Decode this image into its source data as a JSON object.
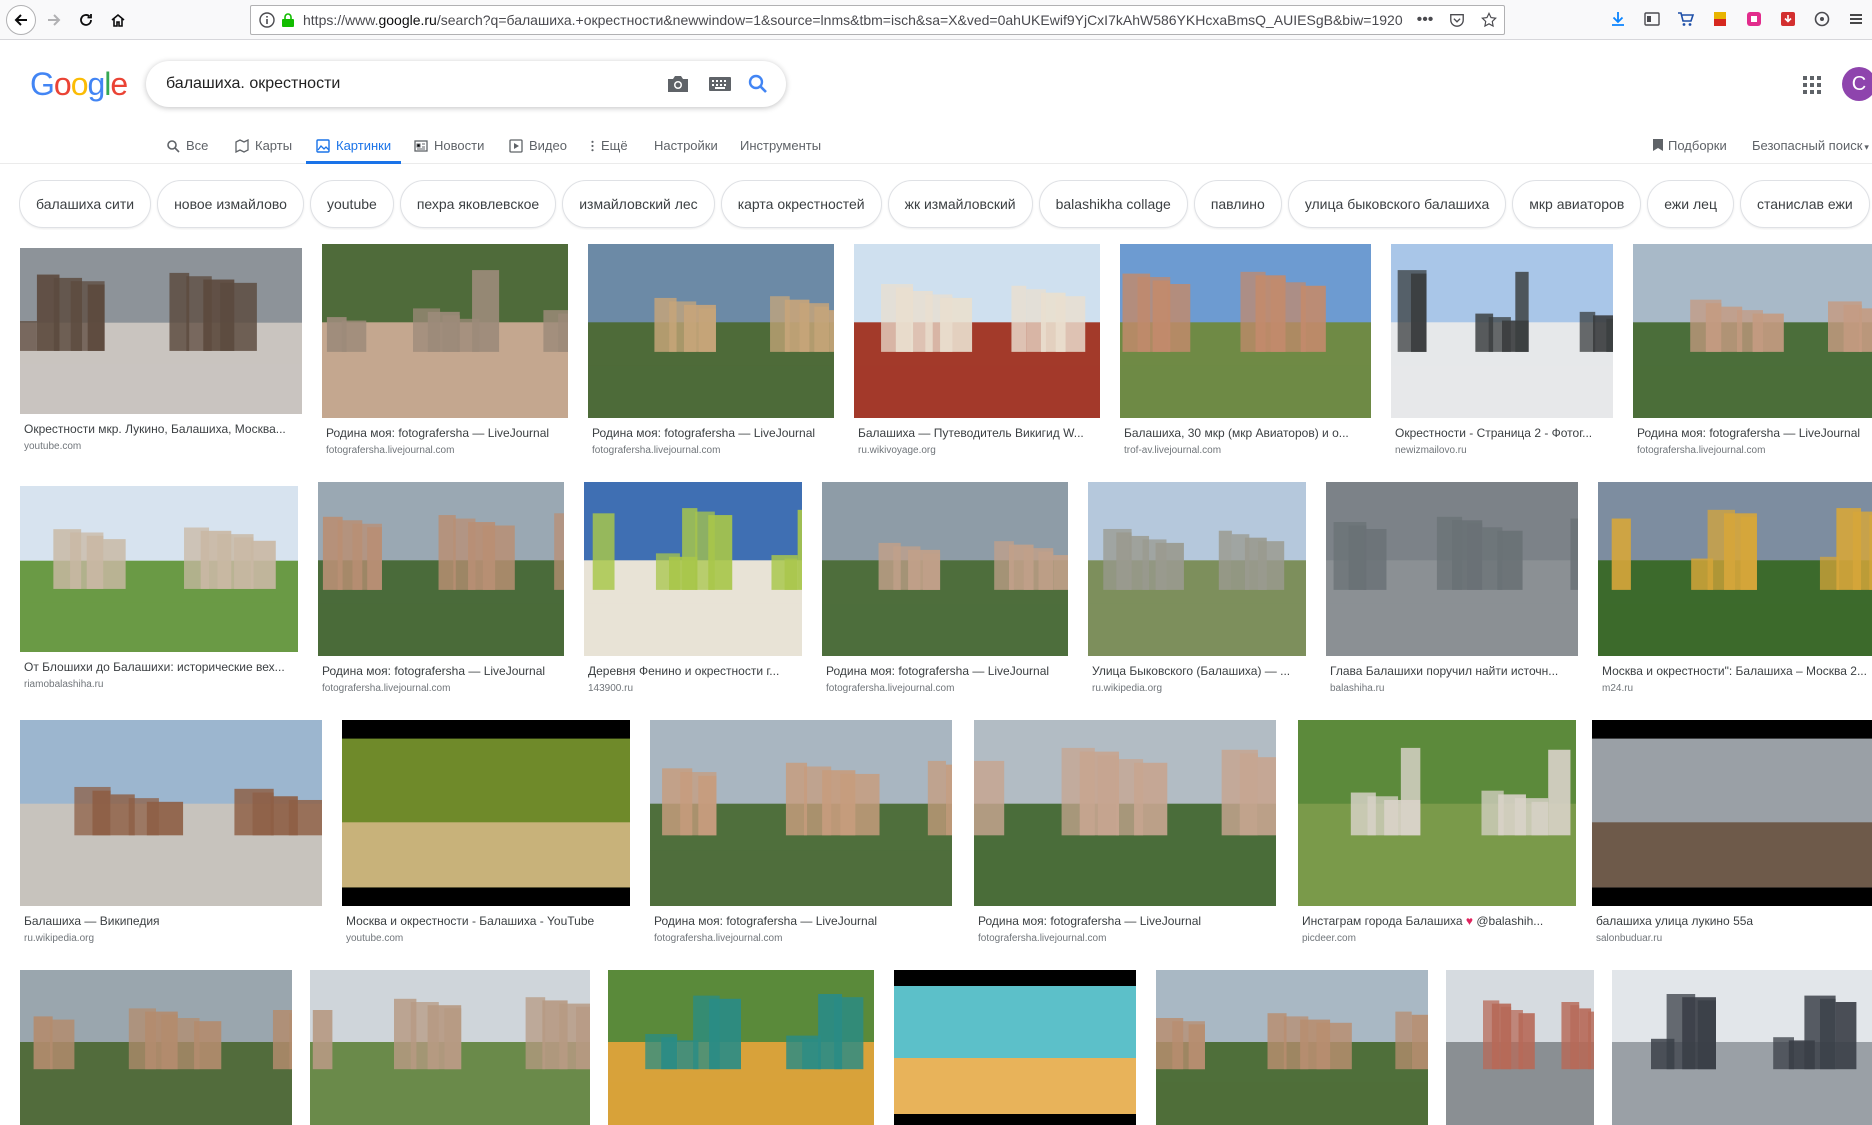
{
  "browser": {
    "url_prefix": "https://www.",
    "url_domain": "google.ru",
    "url_rest": "/search?q=балашиха.+окрестности&newwindow=1&source=lnms&tbm=isch&sa=X&ved=0ahUKEwif9YjCxI7kAhW586YKHcxaBmsQ_AUIESgB&biw=1920",
    "more_label": "•••"
  },
  "search": {
    "query": "балашиха. окрестности",
    "logo_text": "Google",
    "avatar_letter": "С"
  },
  "tabs": [
    {
      "label": "Все",
      "icon": "search-icon"
    },
    {
      "label": "Карты",
      "icon": "map-icon"
    },
    {
      "label": "Картинки",
      "icon": "image-icon",
      "active": true
    },
    {
      "label": "Новости",
      "icon": "news-icon"
    },
    {
      "label": "Видео",
      "icon": "video-icon"
    },
    {
      "label": "Ещё",
      "icon": "more-vert-icon"
    },
    {
      "label": "Настройки"
    },
    {
      "label": "Инструменты"
    }
  ],
  "tabs_right": {
    "collections": "Подборки",
    "safe_search": "Безопасный поиск"
  },
  "chips": [
    "балашиха сити",
    "новое измайлово",
    "youtube",
    "пехра яковлевское",
    "измайловский лес",
    "карта окрестностей",
    "жк измайловский",
    "balashikha collage",
    "павлино",
    "улица быковского балашиха",
    "мкр авиаторов",
    "ежи лец",
    "станислав ежи"
  ],
  "results": [
    {
      "title": "Окрестности мкр. Лукино, Балашиха, Москва...",
      "source": "youtube.com",
      "palette": [
        "#8d9399",
        "#5c4a3e",
        "#c9c4bf"
      ]
    },
    {
      "title": "Родина моя: fotografersha — LiveJournal",
      "source": "fotografersha.livejournal.com",
      "palette": [
        "#4f6b3a",
        "#9c8a7a",
        "#c4a78f"
      ]
    },
    {
      "title": "Родина моя: fotografersha — LiveJournal",
      "source": "fotografersha.livejournal.com",
      "palette": [
        "#6c8aa6",
        "#c7a57a",
        "#4e6b39"
      ]
    },
    {
      "title": "Балашиха — Путеводитель Викигид W...",
      "source": "ru.wikivoyage.org",
      "palette": [
        "#cfe0ef",
        "#e9dfcf",
        "#a33a2a"
      ]
    },
    {
      "title": "Балашиха, 30 мкр (мкр Авиаторов) и о...",
      "source": "trof-av.livejournal.com",
      "palette": [
        "#6d9bd1",
        "#c28a6c",
        "#6f8a45"
      ]
    },
    {
      "title": "Окрестности - Страница 2 - Фотог...",
      "source": "newizmailovo.ru",
      "palette": [
        "#a9c6e8",
        "#3a3d3f",
        "#e6e8ea"
      ]
    },
    {
      "title": "Родина моя: fotografersha — LiveJournal",
      "source": "fotografersha.livejournal.com",
      "palette": [
        "#a8b9c8",
        "#c59b82",
        "#4b6e3a"
      ]
    },
    {
      "title": "От Блошихи до Балашихи: исторические вех...",
      "source": "riamobalashiha.ru",
      "palette": [
        "#d7e3ef",
        "#c9b8a4",
        "#6a9a45"
      ]
    },
    {
      "title": "Родина моя: fotografersha — LiveJournal",
      "source": "fotografersha.livejournal.com",
      "palette": [
        "#9aa8b3",
        "#b98f74",
        "#4a6b3a"
      ]
    },
    {
      "title": "Деревня Фенино и окрестности г...",
      "source": "143900.ru",
      "palette": [
        "#3f6fb3",
        "#a8c64a",
        "#e8e3d6"
      ]
    },
    {
      "title": "Родина моя: fotografersha — LiveJournal",
      "source": "fotografersha.livejournal.com",
      "palette": [
        "#8e9ca7",
        "#c1a089",
        "#4e6e3c"
      ]
    },
    {
      "title": "Улица Быковского (Балашиха) — ...",
      "source": "ru.wikipedia.org",
      "palette": [
        "#b5c8dc",
        "#9a9a8f",
        "#7d8f5c"
      ]
    },
    {
      "title": "Глава Балашихи поручил найти источн...",
      "source": "balashiha.ru",
      "palette": [
        "#7c8288",
        "#6a7176",
        "#8b9094"
      ]
    },
    {
      "title": "Москва и окрестности\": Балашиха – Москва 2...",
      "source": "m24.ru",
      "palette": [
        "#7d8da0",
        "#d6a63a",
        "#3c6a2c"
      ]
    },
    {
      "title": "Балашиха — Википедия",
      "source": "ru.wikipedia.org",
      "palette": [
        "#9cb6cf",
        "#8e5f45",
        "#c7c3bd"
      ]
    },
    {
      "title": "Москва и окрестности - Балашиха - YouTube",
      "source": "youtube.com",
      "palette": [
        "#000000",
        "#6f8a2a",
        "#c8b27a"
      ]
    },
    {
      "title": "Родина моя: fotografersha — LiveJournal",
      "source": "fotografersha.livejournal.com",
      "palette": [
        "#a9b6c1",
        "#c79c7d",
        "#4f6f3c"
      ]
    },
    {
      "title": "Родина моя: fotografersha — LiveJournal",
      "source": "fotografersha.livejournal.com",
      "palette": [
        "#b2bcc4",
        "#c7a590",
        "#4a6d3a"
      ]
    },
    {
      "title": "Инстаграм города Балашиха ♥ @balashih...",
      "source": "picdeer.com",
      "palette": [
        "#5c8a3b",
        "#d8d2c8",
        "#7a9a4a"
      ]
    },
    {
      "title": "балашиха улица лукино 55а",
      "source": "salonbuduar.ru",
      "palette": [
        "#000000",
        "#9aa0a6",
        "#6e5a4a"
      ]
    },
    {
      "title": "",
      "source": "",
      "palette": [
        "#9aa6ae",
        "#b38c6e",
        "#526c3c"
      ]
    },
    {
      "title": "",
      "source": "",
      "palette": [
        "#cfd5da",
        "#b79a83",
        "#6a8a4a"
      ]
    },
    {
      "title": "",
      "source": "",
      "palette": [
        "#5a8a3a",
        "#2a8c86",
        "#d8a23a"
      ]
    },
    {
      "title": "",
      "source": "",
      "palette": [
        "#000000",
        "#5cc0c9",
        "#e8b35a"
      ]
    },
    {
      "title": "",
      "source": "",
      "palette": [
        "#a9b8c4",
        "#b88e70",
        "#4f6f3a"
      ]
    },
    {
      "title": "",
      "source": "",
      "palette": [
        "#d6dbe0",
        "#b76a58",
        "#8a8f93"
      ]
    },
    {
      "title": "",
      "source": "",
      "palette": [
        "#e2e6ea",
        "#3a3f47",
        "#9aa0a6"
      ]
    }
  ]
}
